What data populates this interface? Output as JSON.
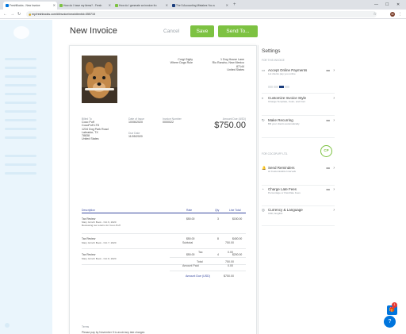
{
  "browser": {
    "tabs": [
      {
        "label": "FreshBooks - New Invoice",
        "fav_color": "#0075dd",
        "active": true
      },
      {
        "label": "How do I have my items? - Fresh",
        "fav_color": "#7dc242",
        "active": false
      },
      {
        "label": "How do I generate an invoice fro",
        "fav_color": "#7dc242",
        "active": false
      },
      {
        "label": "The 5 Accounting Mistakes You a",
        "fav_color": "#1a3d7c",
        "active": false
      }
    ],
    "new_tab": "+",
    "url": "my.freshbooks.com/#/invoice/new/clientid=355715",
    "window_controls": [
      "—",
      "☐",
      "✕"
    ],
    "profile_initial": "M"
  },
  "header": {
    "title": "New Invoice",
    "cancel_label": "Cancel",
    "save_label": "Save",
    "send_label": "Send To..."
  },
  "invoice": {
    "business_name": "Corgi Gigity\nWhere Dogs Rule",
    "business_address": "1 Dog House Lane\nRio Rancho, New Mexico\n87144\nUnited States",
    "billed_to_label": "Billed To",
    "billed_to": "Coco Puff\nCocoPuff LTD\n1234 Dog Park Road\nLabrador, TX\n78838\nUnited States",
    "date_of_issue_label": "Date of Issue",
    "date_of_issue": "10/06/2020",
    "due_date_label": "Due Date",
    "due_date": "11/05/2020",
    "invoice_number_label": "Invoice Number",
    "invoice_number": "0000022",
    "amount_due_label": "Amount Due (USD)",
    "amount_due": "$750.00",
    "columns": [
      "Description",
      "Rate",
      "Qty",
      "Line Total"
    ],
    "lines": [
      {
        "name": "Tax Review",
        "desc": "Mary Grinch Book - Oct 6, 2020\nReviewing tax returns for Coco Puff",
        "rate": "$50.00",
        "qty": "3",
        "total": "$150.00"
      },
      {
        "name": "Tax Review",
        "desc": "Mary Grinch Book - Oct 7, 2020",
        "rate": "$50.00",
        "qty": "8",
        "total": "$400.00"
      },
      {
        "name": "Tax Review",
        "desc": "Mary Grinch Book - Oct 8, 2020",
        "rate": "$50.00",
        "qty": "4",
        "total": "$200.00"
      }
    ],
    "subtotal_label": "Subtotal",
    "subtotal": "750.00",
    "tax_label": "Tax",
    "tax": "0.00",
    "total_label": "Total",
    "total": "750.00",
    "amount_paid_label": "Amount Paid",
    "amount_paid": "0.00",
    "amount_due_usd_label": "Amount Due (USD)",
    "amount_due_usd": "$750.00",
    "terms_label": "Terms",
    "terms": "Please pay by November 5 to avoid any late charges"
  },
  "settings": {
    "title": "Settings",
    "section_invoice": "FOR THIS INVOICE",
    "section_client": "FOR COCOPUFF LTD.",
    "client_initials": "CP",
    "rows": [
      {
        "title": "Accept Online Payments",
        "sub": "Let clients pay you online",
        "toggle": "NO"
      },
      {
        "title": "Customize Invoice Style",
        "sub": "Change Template, Color, and Font",
        "toggle": ""
      },
      {
        "title": "Make Recurring",
        "sub": "Bill your clients automatically",
        "toggle": "NO"
      },
      {
        "title": "Send Reminders",
        "sub": "At Customizable Intervals",
        "toggle": "NO"
      },
      {
        "title": "Charge Late Fees",
        "sub": "Percentage or Flat-Rate Fees",
        "toggle": "NO"
      },
      {
        "title": "Currency & Language",
        "sub": "USD, English",
        "toggle": ""
      }
    ]
  },
  "widgets": {
    "help": "?",
    "gift": "🎁",
    "gift_badge": "1"
  }
}
